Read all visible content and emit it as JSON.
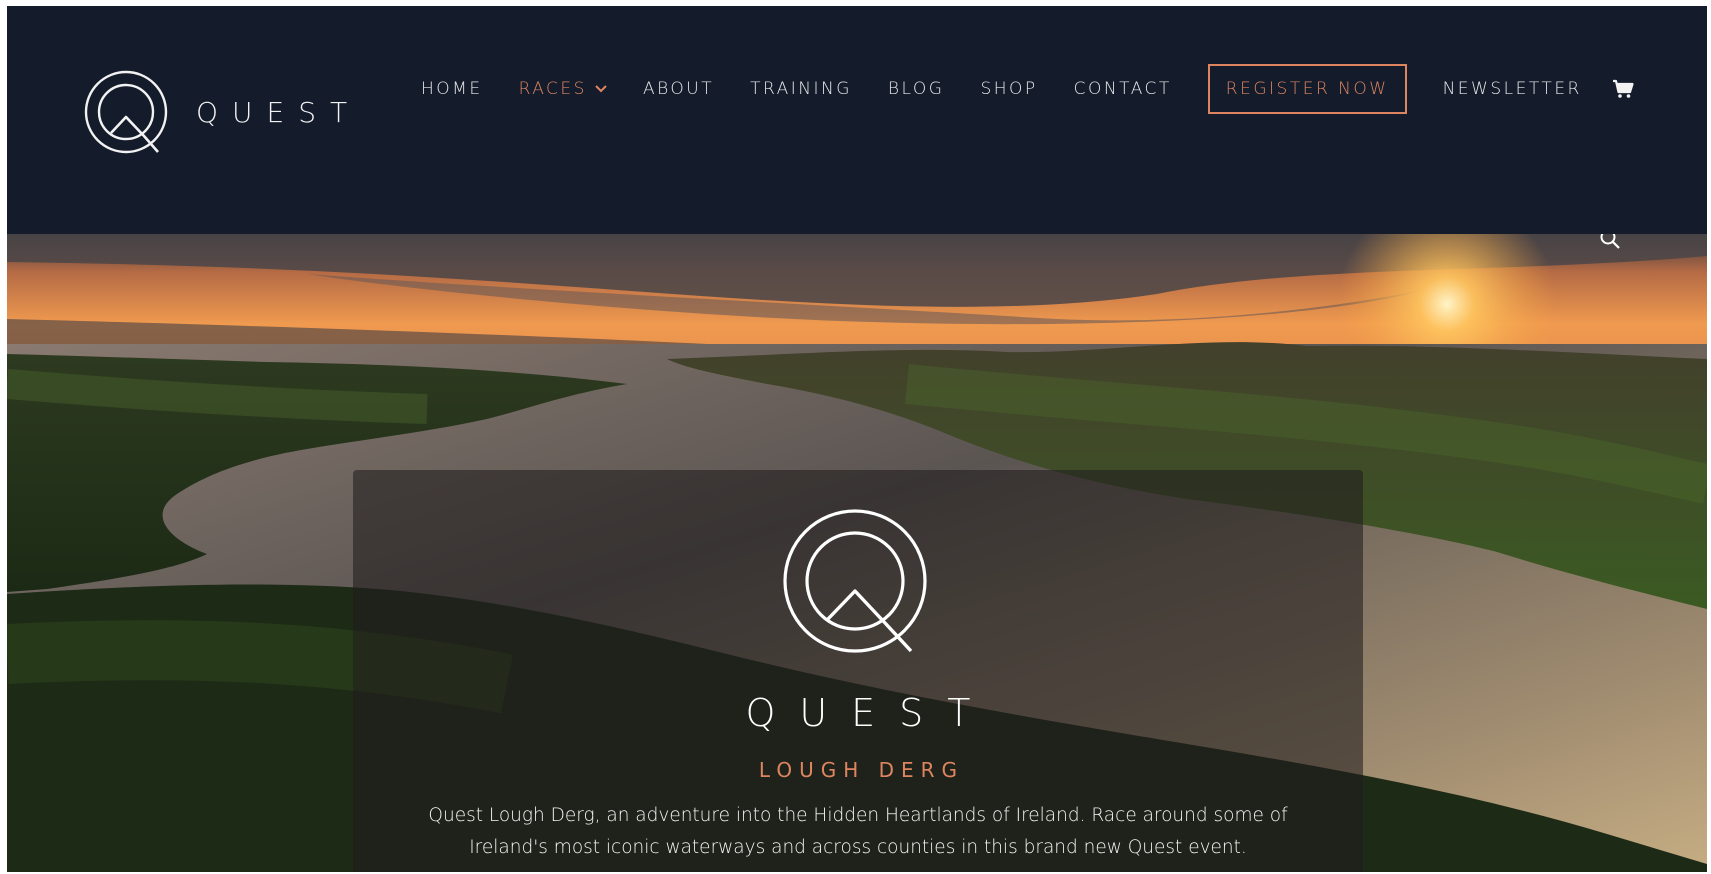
{
  "header": {
    "logo_text": "QUEST",
    "nav": [
      {
        "label": "HOME"
      },
      {
        "label": "RACES"
      },
      {
        "label": "ABOUT"
      },
      {
        "label": "TRAINING"
      },
      {
        "label": "BLOG"
      },
      {
        "label": "SHOP"
      },
      {
        "label": "CONTACT"
      }
    ],
    "register_label": "REGISTER NOW",
    "newsletter_label": "NEWSLETTER",
    "cart_icon": "shopping-cart-icon",
    "active_color": "#de8560",
    "background_color": "#141c2c"
  },
  "hero": {
    "title": "QUEST",
    "subtitle": "LOUGH DERG",
    "description": "Quest Lough Derg, an adventure into the Hidden Heartlands of Ireland. Race around some of Ireland's most iconic waterways and across counties in this brand new Quest event.",
    "search_icon": "search-icon"
  }
}
